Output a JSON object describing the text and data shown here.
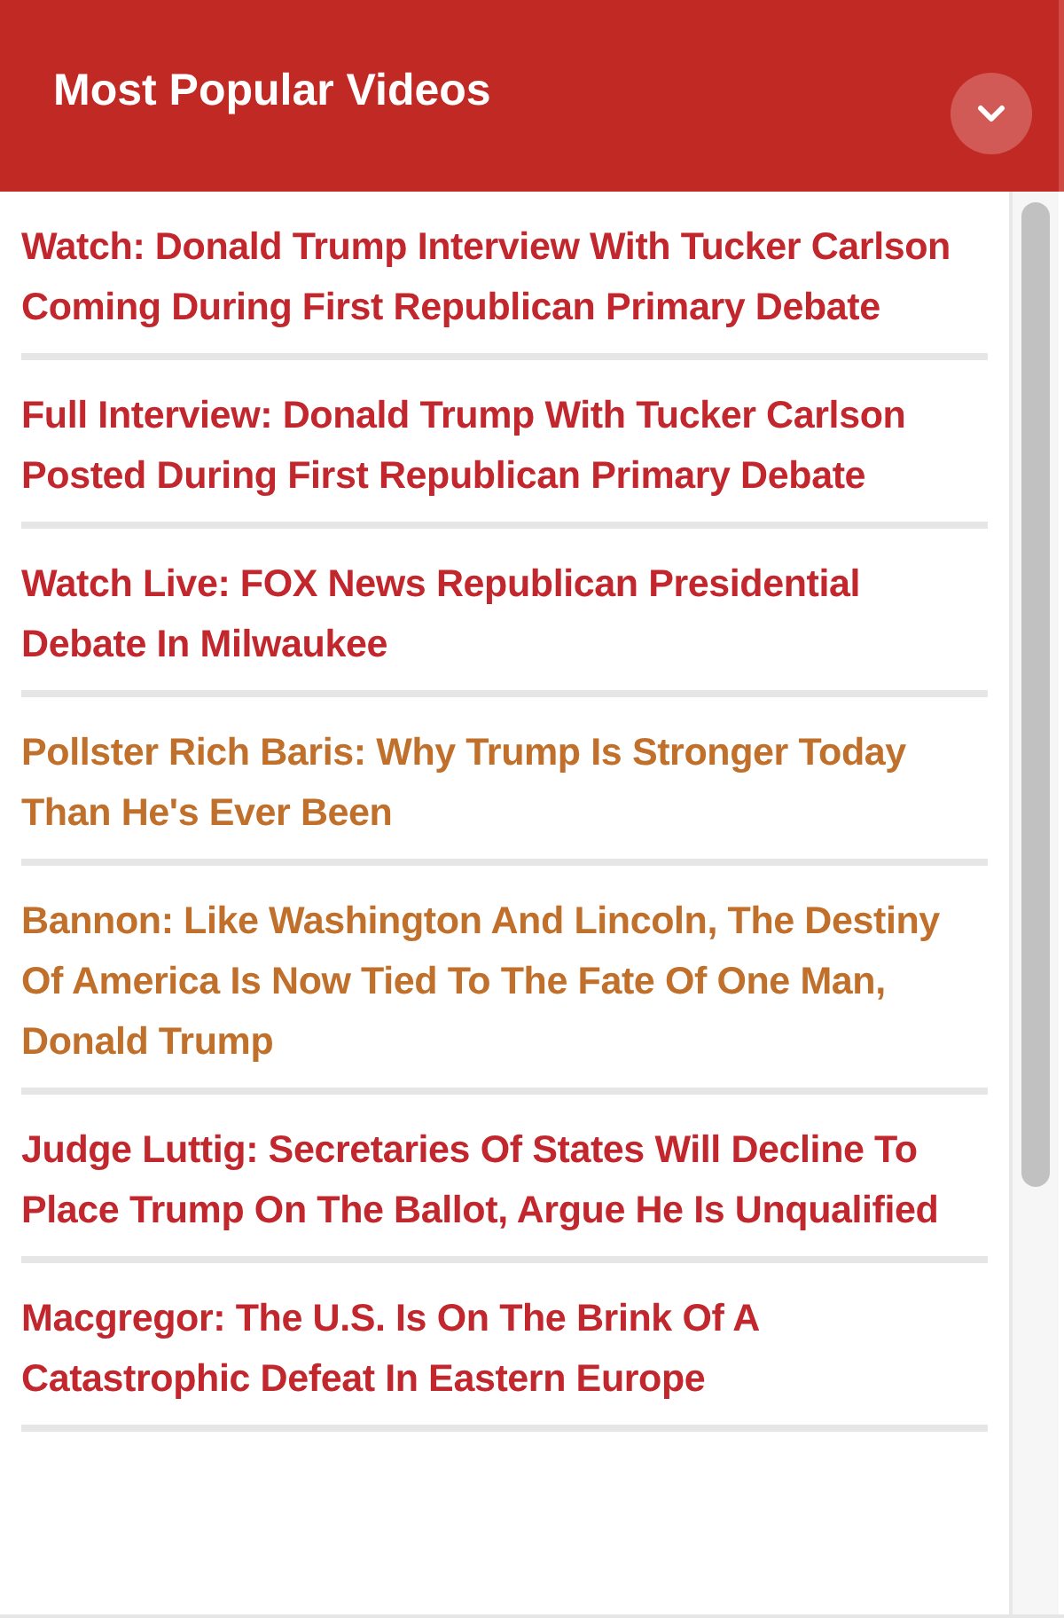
{
  "header": {
    "title": "Most Popular Videos"
  },
  "videos": [
    {
      "title": "Watch: Donald Trump Interview With Tucker Carlson Coming During First Republican Primary Debate",
      "color": "#c1272d"
    },
    {
      "title": "Full Interview: Donald Trump With Tucker Carlson Posted During First Republican Primary Debate",
      "color": "#c1272d"
    },
    {
      "title": "Watch Live: FOX News Republican Presidential Debate In Milwaukee",
      "color": "#c1272d"
    },
    {
      "title": "Pollster Rich Baris: Why Trump Is Stronger Today Than He's Ever Been",
      "color": "#c0702b"
    },
    {
      "title": "Bannon: Like Washington And Lincoln, The Destiny Of America Is Now Tied To The Fate Of One Man, Donald Trump",
      "color": "#c0702b"
    },
    {
      "title": "Judge Luttig: Secretaries Of States Will Decline To Place Trump On The Ballot, Argue He Is Unqualified",
      "color": "#c1272d"
    },
    {
      "title": "Macgregor: The U.S. Is On The Brink Of A Catastrophic Defeat In Eastern Europe",
      "color": "#c1272d"
    }
  ]
}
